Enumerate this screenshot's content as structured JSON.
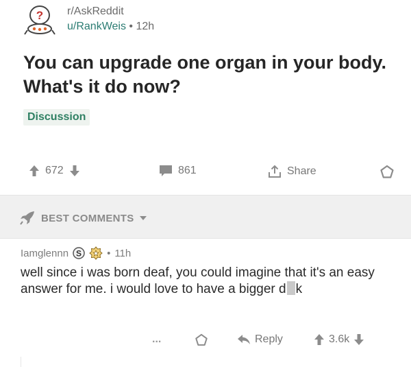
{
  "post": {
    "subreddit": "r/AskReddit",
    "author": "u/RankWeis",
    "separator": "•",
    "age": "12h",
    "title": "You can upgrade one organ in your body. What's it do now?",
    "flair": "Discussion",
    "score": "672",
    "comments": "861",
    "share_label": "Share"
  },
  "sort": {
    "label": "BEST COMMENTS"
  },
  "comment": {
    "author": "Iamglennn",
    "separator": "•",
    "age": "11h",
    "body_before": "well since i was born deaf, you could imagine that it's an easy answer for me. i would love to have a bigger d",
    "body_after": "k",
    "more": "...",
    "reply_label": "Reply",
    "score": "3.6k"
  },
  "colors": {
    "accent": "#2b7c72",
    "flair_bg": "#eef3ef",
    "band_bg": "#f0f0f0",
    "icon": "#8c8c8c"
  },
  "icons": [
    "subreddit-avatar-icon",
    "upvote-icon",
    "downvote-icon",
    "comment-icon",
    "share-icon",
    "save-icon",
    "rocket-icon",
    "chevron-down-icon",
    "silver-award-icon",
    "gold-award-icon",
    "more-icon",
    "reply-icon"
  ]
}
